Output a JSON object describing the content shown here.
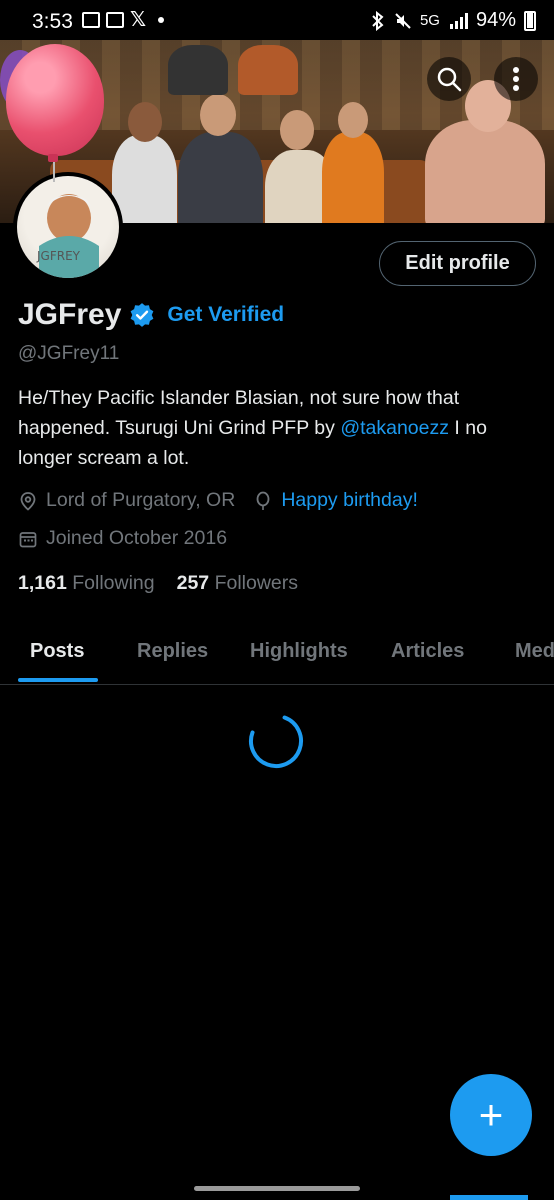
{
  "status_bar": {
    "time": "3:53",
    "network": "5G",
    "battery": "94%"
  },
  "profile": {
    "display_name": "JGFrey",
    "get_verified_label": "Get Verified",
    "handle": "@JGFrey11",
    "bio_prefix": "He/They  Pacific Islander Blasian, not sure how that happened.  Tsurugi Uni Grind  PFP by ",
    "bio_mention": "@takanoezz",
    "bio_suffix": " I no longer scream a lot.",
    "location": "Lord of Purgatory, OR",
    "birthday_label": "Happy birthday!",
    "joined": "Joined October 2016",
    "following_count": "1,161",
    "following_label": "Following",
    "followers_count": "257",
    "followers_label": "Followers",
    "edit_profile_label": "Edit profile",
    "avatar_text": "JGFREY"
  },
  "tabs": [
    {
      "label": "Posts",
      "active": true
    },
    {
      "label": "Replies",
      "active": false
    },
    {
      "label": "Highlights",
      "active": false
    },
    {
      "label": "Articles",
      "active": false
    },
    {
      "label": "Media",
      "active": false
    }
  ],
  "fab": {
    "label": "+"
  },
  "colors": {
    "accent": "#1d9bf0",
    "text_primary": "#e7e9ea",
    "text_secondary": "#71767b",
    "background": "#000000",
    "balloon": "#e9506e"
  },
  "icons": {
    "search": "search-icon",
    "more": "more-vertical-icon",
    "verified": "verified-badge-icon",
    "location": "location-pin-icon",
    "birthday": "balloon-icon",
    "calendar": "calendar-icon",
    "compose": "plus-icon"
  }
}
